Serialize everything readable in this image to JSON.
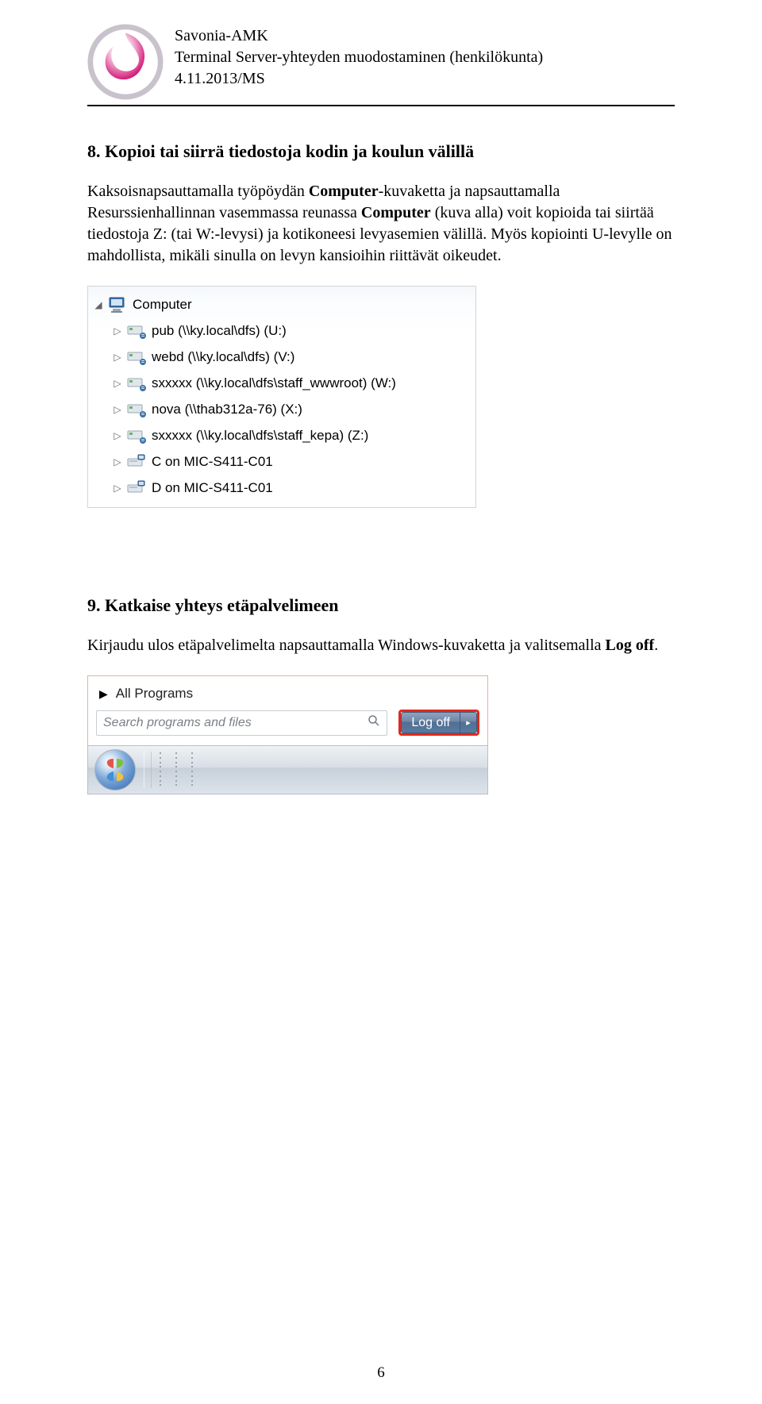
{
  "header": {
    "org": "Savonia-AMK",
    "title": "Terminal Server-yhteyden muodostaminen (henkilökunta)",
    "date": "4.11.2013/MS"
  },
  "section8": {
    "title": "8. Kopioi tai siirrä tiedostoja kodin ja koulun välillä",
    "p1a": "Kaksoisnapsauttamalla työpöydän ",
    "p1b": "Computer",
    "p1c": "-kuvaketta ja napsauttamalla Resurssienhallinnan vasemmassa reunassa ",
    "p1d": "Computer",
    "p1e": " (kuva alla) voit kopioida tai siirtää tiedostoja Z: (tai W:-levysi) ja kotikoneesi levyasemien välillä. Myös kopiointi U-levylle on mahdollista, mikäli sinulla on levyn kansioihin riittävät oikeudet."
  },
  "tree": {
    "root": "Computer",
    "items": [
      "pub (\\\\ky.local\\dfs) (U:)",
      "webd (\\\\ky.local\\dfs) (V:)",
      "sxxxxx (\\\\ky.local\\dfs\\staff_wwwroot) (W:)",
      "nova (\\\\thab312a-76) (X:)",
      "sxxxxx (\\\\ky.local\\dfs\\staff_kepa) (Z:)",
      "C on MIC-S411-C01",
      "D on MIC-S411-C01"
    ]
  },
  "section9": {
    "title": "9. Katkaise yhteys etäpalvelimeen",
    "p1a": "Kirjaudu ulos etäpalvelimelta napsauttamalla Windows-kuvaketta ja valitsemalla ",
    "p1b": "Log off",
    "p1c": "."
  },
  "startmenu": {
    "all_programs": "All Programs",
    "search_placeholder": "Search programs and files",
    "logoff": "Log off"
  },
  "page_number": "6"
}
